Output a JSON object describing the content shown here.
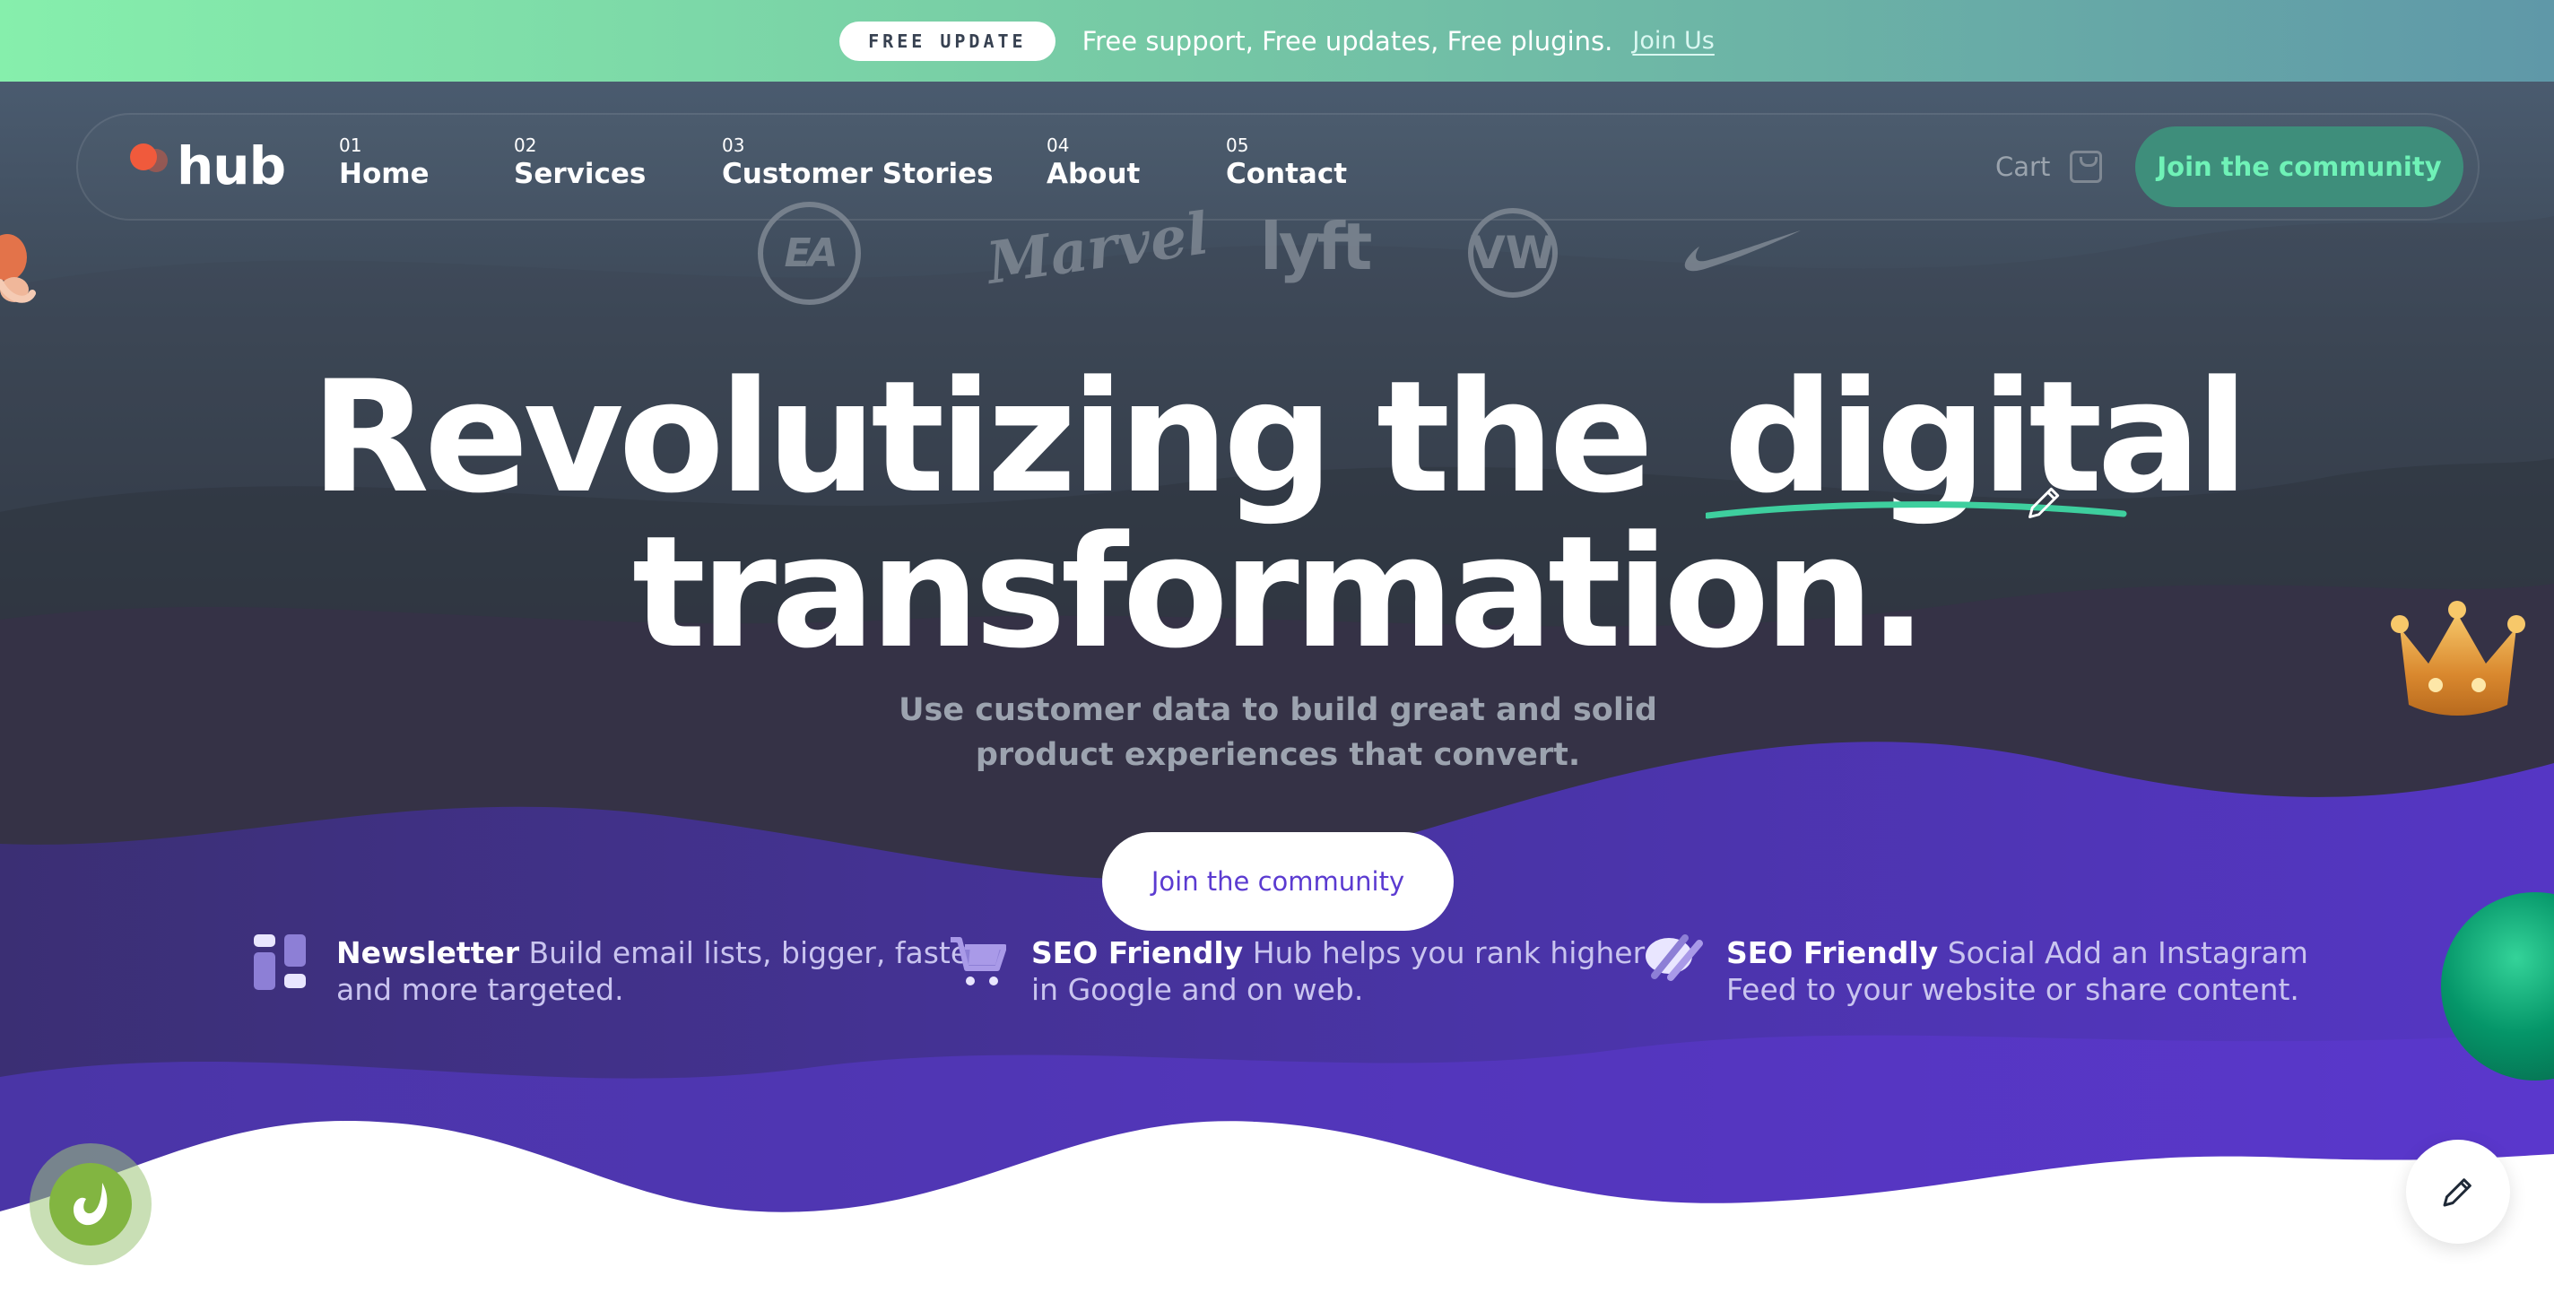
{
  "announcement": {
    "badge": "FREE UPDATE",
    "message": "Free support, Free updates, Free plugins.",
    "link": "Join Us"
  },
  "nav": {
    "logo": "hub",
    "items": [
      {
        "num": "01",
        "label": "Home"
      },
      {
        "num": "02",
        "label": "Services"
      },
      {
        "num": "03",
        "label": "Customer Stories"
      },
      {
        "num": "04",
        "label": "About"
      },
      {
        "num": "05",
        "label": "Contact"
      }
    ],
    "cart_label": "Cart",
    "cta": "Join the community"
  },
  "brands": [
    "EA",
    "Marvel",
    "lyft",
    "VW",
    "Nike"
  ],
  "hero": {
    "headline_part1": "Revolutizing the",
    "headline_highlight": "digital",
    "headline_line2": "transformation.",
    "subtitle": "Use customer data to build great and solid product experiences that convert.",
    "cta": "Join the community"
  },
  "features": [
    {
      "title": "Newsletter",
      "text": "Build email lists, bigger, faster and more targeted.",
      "icon": "newsletter-icon"
    },
    {
      "title": "SEO Friendly",
      "text": "Hub helps you rank higher in Google and on web.",
      "icon": "cart-icon"
    },
    {
      "title": "SEO Friendly",
      "text": "Social Add an Instagram Feed to your website or share content.",
      "icon": "social-icon"
    }
  ],
  "colors": {
    "accent_green": "#3e8e7b",
    "accent_green_text": "#6ff2b7",
    "purple": "#5b3bd1",
    "underline": "#3ecf9e",
    "logo_dot": "#f05a3c"
  }
}
